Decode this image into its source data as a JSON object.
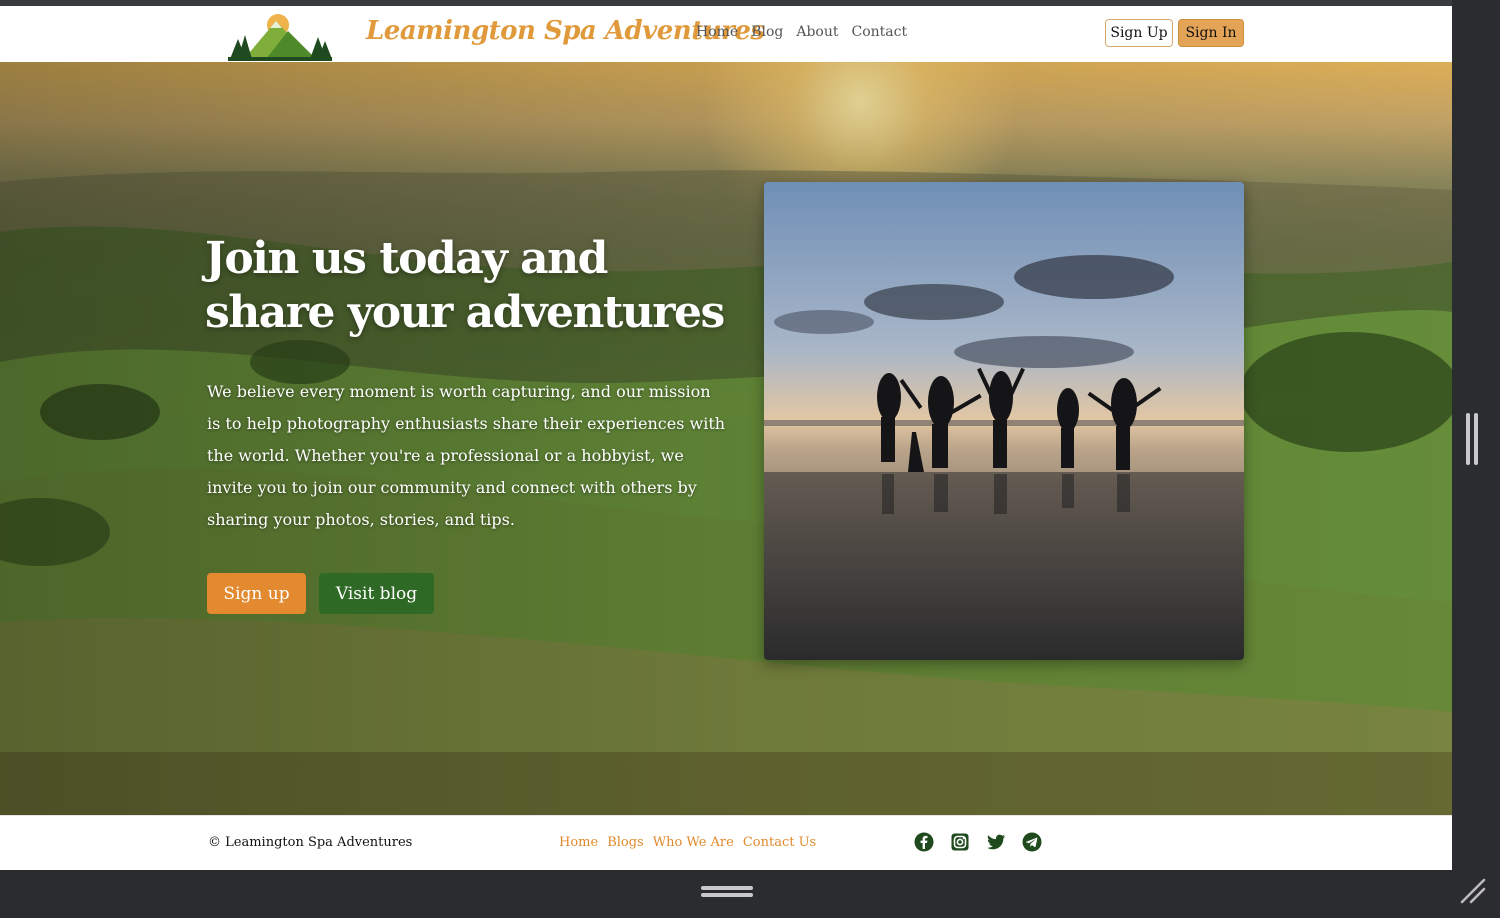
{
  "header": {
    "brand": "Leamington Spa Adventures",
    "nav": [
      "Home",
      "Blog",
      "About",
      "Contact"
    ],
    "sign_up": "Sign Up",
    "sign_in": "Sign In"
  },
  "hero": {
    "title": "Join us today and share your adventures",
    "description": "We believe every moment is worth capturing, and our mission is to help photography enthusiasts share their experiences with the world. Whether you're a professional or a hobbyist, we invite you to join our community and connect with others by sharing your photos, stories, and tips.",
    "primary_button": "Sign up",
    "secondary_button": "Visit blog"
  },
  "footer": {
    "copyright": "© Leamington Spa Adventures",
    "links": [
      "Home",
      "Blogs",
      "Who We Are",
      "Contact Us"
    ],
    "social_icons": [
      "facebook-icon",
      "instagram-icon",
      "twitter-icon",
      "telegram-icon"
    ]
  },
  "colors": {
    "accent": "#e3892f",
    "brand": "#e09a3c",
    "secondary": "#2e6a25",
    "footer_link": "#e08a2c"
  }
}
